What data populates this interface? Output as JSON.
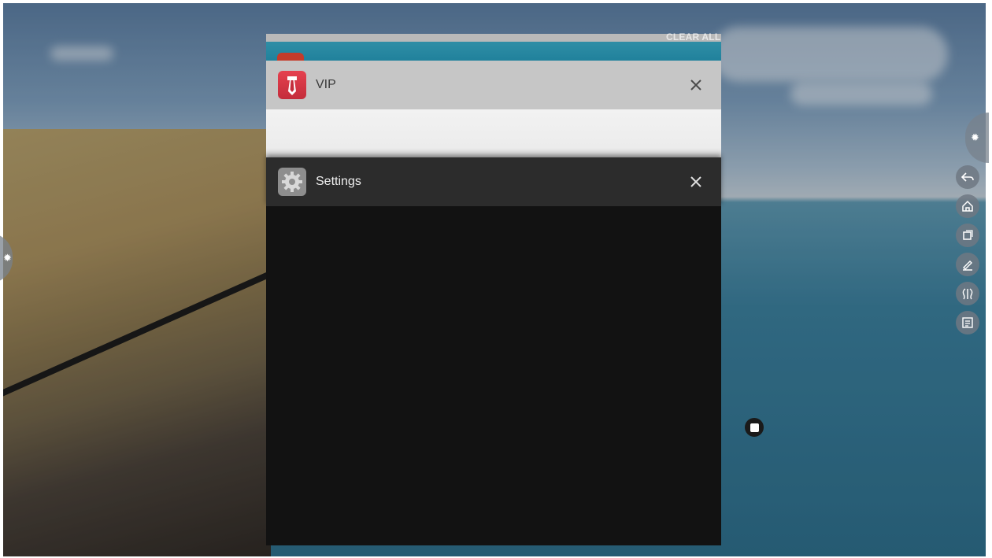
{
  "recents": {
    "clear_all_label": "CLEAR ALL",
    "cards": [
      {
        "title": "VIP",
        "icon": "tie-icon"
      },
      {
        "title": "Settings",
        "icon": "gear-icon"
      }
    ]
  },
  "toolbar": {
    "items": [
      "back-icon",
      "home-icon",
      "recents-icon",
      "pen-icon",
      "split-icon",
      "window-icon"
    ]
  },
  "colors": {
    "vip_header": "#c6c6c6",
    "settings_header": "#2c2c2c",
    "card_back_accent": "#1d7e99"
  }
}
